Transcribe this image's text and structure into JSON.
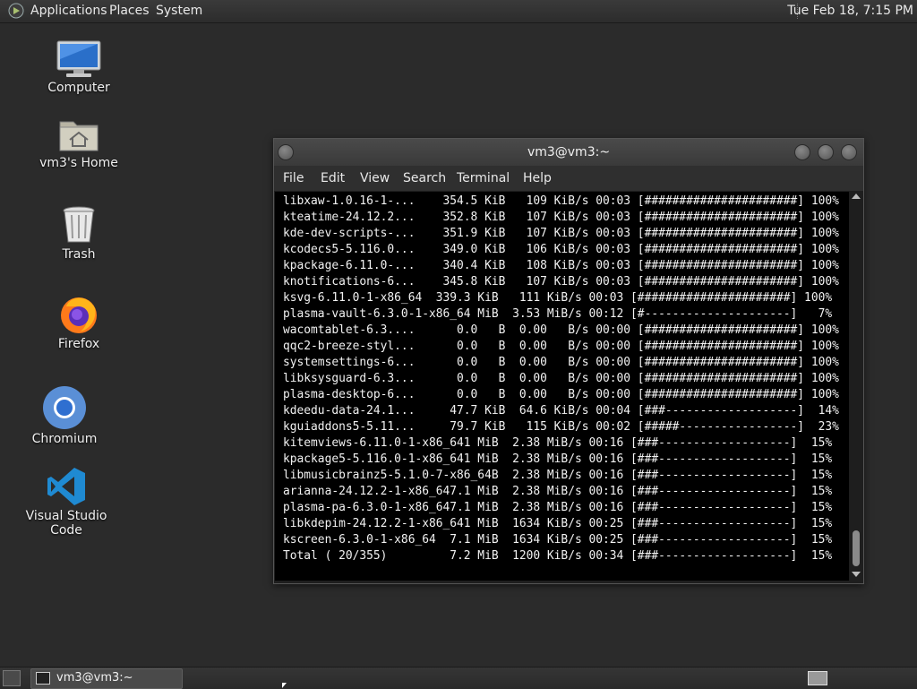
{
  "top_panel": {
    "menus": [
      "Applications",
      "Places",
      "System"
    ],
    "clock": "Tue Feb 18,  7:15 PM"
  },
  "desktop_icons": [
    {
      "label": "Computer",
      "icon": "computer-icon"
    },
    {
      "label": "vm3's Home",
      "icon": "home-folder-icon"
    },
    {
      "label": "Trash",
      "icon": "trash-icon"
    },
    {
      "label": "Firefox",
      "icon": "firefox-icon"
    },
    {
      "label": "Chromium",
      "icon": "chromium-icon"
    },
    {
      "label": "Visual Studio Code",
      "icon": "vscode-icon"
    }
  ],
  "terminal": {
    "title": "vm3@vm3:~",
    "menu": [
      "File",
      "Edit",
      "View",
      "Search",
      "Terminal",
      "Help"
    ],
    "lines": [
      "libxaw-1.0.16-1-...    354.5 KiB   109 KiB/s 00:03 [######################] 100%",
      "kteatime-24.12.2...    352.8 KiB   107 KiB/s 00:03 [######################] 100%",
      "kde-dev-scripts-...    351.9 KiB   107 KiB/s 00:03 [######################] 100%",
      "kcodecs5-5.116.0...    349.0 KiB   106 KiB/s 00:03 [######################] 100%",
      "kpackage-6.11.0-...    340.4 KiB   108 KiB/s 00:03 [######################] 100%",
      "knotifications-6...    345.8 KiB   107 KiB/s 00:03 [######################] 100%",
      "ksvg-6.11.0-1-x86_64  339.3 KiB   111 KiB/s 00:03 [######################] 100%",
      "plasma-vault-6.3.0-1-x86_64 MiB  3.53 MiB/s 00:12 [#---------------------]   7%",
      "wacomtablet-6.3....      0.0   B  0.00   B/s 00:00 [######################] 100%",
      "qqc2-breeze-styl...      0.0   B  0.00   B/s 00:00 [######################] 100%",
      "systemsettings-6...      0.0   B  0.00   B/s 00:00 [######################] 100%",
      "libksysguard-6.3...      0.0   B  0.00   B/s 00:00 [######################] 100%",
      "plasma-desktop-6...      0.0   B  0.00   B/s 00:00 [######################] 100%",
      "kdeedu-data-24.1...     47.7 KiB  64.6 KiB/s 00:04 [###-------------------]  14%",
      "kguiaddons5-5.11...     79.7 KiB   115 KiB/s 00:02 [#####-----------------]  23%",
      "kitemviews-6.11.0-1-x86_641 MiB  2.38 MiB/s 00:16 [###-------------------]  15%",
      "kpackage5-5.116.0-1-x86_641 MiB  2.38 MiB/s 00:16 [###-------------------]  15%",
      "libmusicbrainz5-5.1.0-7-x86_64B  2.38 MiB/s 00:16 [###-------------------]  15%",
      "arianna-24.12.2-1-x86_647.1 MiB  2.38 MiB/s 00:16 [###-------------------]  15%",
      "plasma-pa-6.3.0-1-x86_647.1 MiB  2.38 MiB/s 00:16 [###-------------------]  15%",
      "libkdepim-24.12.2-1-x86_641 MiB  1634 KiB/s 00:25 [###-------------------]  15%",
      "kscreen-6.3.0-1-x86_64  7.1 MiB  1634 KiB/s 00:25 [###-------------------]  15%",
      "Total ( 20/355)         7.2 MiB  1200 KiB/s 00:34 [###-------------------]  15%"
    ]
  },
  "taskbar": {
    "window_label": "vm3@vm3:~"
  }
}
